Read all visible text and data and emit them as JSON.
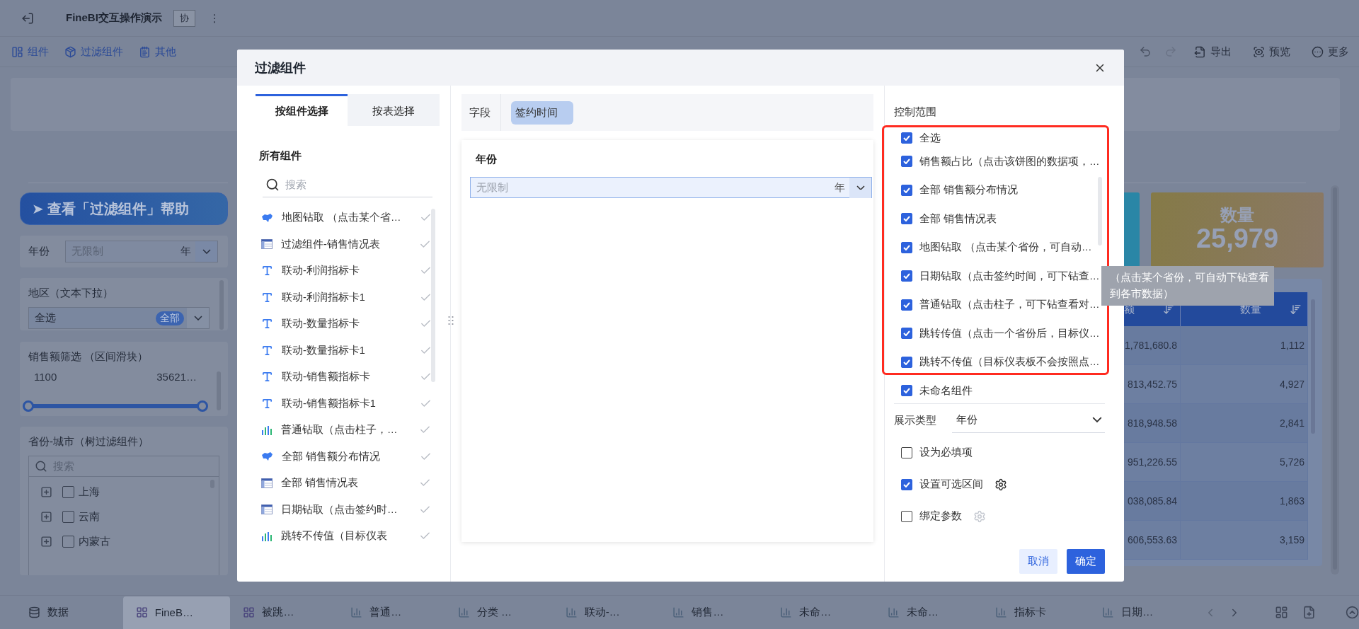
{
  "app_bar": {
    "title": "FineBI交互操作演示",
    "collab_tag": "协",
    "more": "⋮"
  },
  "toolbar": {
    "left": [
      "组件",
      "过滤组件",
      "其他"
    ],
    "right": [
      "导出",
      "预览",
      "更多"
    ]
  },
  "filters": {
    "help_button": "➤ 查看「过滤组件」帮助",
    "year": {
      "label": "年份",
      "placeholder": "无限制",
      "unit": "年"
    },
    "region": {
      "title": "地区（文本下拉）",
      "value": "全选",
      "badge": "全部"
    },
    "sales": {
      "title": "销售额筛选 （区间滑块）",
      "min": "1100",
      "max": "35621…",
      "level": 1
    },
    "province": {
      "title": "省份-城市（树过滤组件）",
      "placeholder": "搜索",
      "nodes": [
        {
          "label": "上海",
          "checked": false
        },
        {
          "label": "云南",
          "checked": false
        },
        {
          "label": "内蒙古",
          "checked": false
        }
      ]
    }
  },
  "kpi": {
    "title": "数量",
    "value": "25,979"
  },
  "table": {
    "columns": [
      "额",
      "数量"
    ],
    "rows": [
      [
        "1,781,680.8",
        "1,112"
      ],
      [
        "813,452.75",
        "4,927"
      ],
      [
        "818,948.58",
        "2,841"
      ],
      [
        "951,226.55",
        "5,726"
      ],
      [
        "038,085.84",
        "1,863"
      ],
      [
        "606,553.63",
        "3,159"
      ]
    ]
  },
  "tabs": [
    {
      "label": "数据",
      "kind": "data",
      "selected": false
    },
    {
      "label": "FineB…",
      "kind": "dashboard",
      "selected": true
    },
    {
      "label": "被跳…",
      "kind": "dashboard",
      "selected": false
    },
    {
      "label": "普通…",
      "kind": "chart",
      "selected": false
    },
    {
      "label": "分类 …",
      "kind": "chart",
      "selected": false
    },
    {
      "label": "联动-…",
      "kind": "chart",
      "selected": false
    },
    {
      "label": "销售…",
      "kind": "chart",
      "selected": false
    },
    {
      "label": "未命…",
      "kind": "chart",
      "selected": false
    },
    {
      "label": "未命…",
      "kind": "chart",
      "selected": false
    },
    {
      "label": "指标卡",
      "kind": "chart",
      "selected": false
    },
    {
      "label": "日期…",
      "kind": "chart",
      "selected": false
    }
  ],
  "dialog": {
    "title": "过滤组件",
    "tabs": [
      {
        "label": "按组件选择",
        "selected": true
      },
      {
        "label": "按表选择",
        "selected": false
      }
    ],
    "list_title": "所有组件",
    "search_placeholder": "搜索",
    "components": [
      {
        "kind": "map",
        "label": "地图钻取 （点击某个省…",
        "linked": true
      },
      {
        "kind": "table",
        "label": "过滤组件-销售情况表",
        "linked": true
      },
      {
        "kind": "text",
        "label": "联动-利润指标卡",
        "linked": true
      },
      {
        "kind": "text",
        "label": "联动-利润指标卡1",
        "linked": true
      },
      {
        "kind": "text",
        "label": "联动-数量指标卡",
        "linked": true
      },
      {
        "kind": "text",
        "label": "联动-数量指标卡1",
        "linked": true
      },
      {
        "kind": "text",
        "label": "联动-销售额指标卡",
        "linked": true
      },
      {
        "kind": "text",
        "label": "联动-销售额指标卡1",
        "linked": true
      },
      {
        "kind": "bar",
        "label": "普通钻取（点击柱子，…",
        "linked": true
      },
      {
        "kind": "map",
        "label": "全部 销售额分布情况",
        "linked": true
      },
      {
        "kind": "table",
        "label": "全部 销售情况表",
        "linked": true
      },
      {
        "kind": "table",
        "label": "日期钻取（点击签约时…",
        "linked": true
      },
      {
        "kind": "bar",
        "label": "跳转不传值（目标仪表",
        "linked": true
      }
    ],
    "field": {
      "label": "字段",
      "chip": "签约时间"
    },
    "preview": {
      "title": "年份",
      "placeholder": "无限制",
      "unit": "年"
    },
    "scope": {
      "title": "控制范围",
      "select_all": {
        "label": "全选",
        "checked": true
      },
      "items": [
        {
          "label": "销售额占比（点击该饼图的数据项，…",
          "checked": true
        },
        {
          "label": "全部 销售额分布情况",
          "checked": true
        },
        {
          "label": "全部 销售情况表",
          "checked": true
        },
        {
          "label": "地图钻取 （点击某个省份，可自动…",
          "checked": true
        },
        {
          "label": "日期钻取（点击签约时间，可下钻查…",
          "checked": true
        },
        {
          "label": "普通钻取（点击柱子，可下钻查看对…",
          "checked": true
        },
        {
          "label": "跳转传值（点击一个省份后，目标仪…",
          "checked": true
        },
        {
          "label": "跳转不传值（目标仪表板不会按照点…",
          "checked": true
        },
        {
          "label": "未命名组件",
          "checked": true
        }
      ]
    },
    "display_type": {
      "label": "展示类型",
      "value": "年份"
    },
    "options": [
      {
        "label": "设为必填项",
        "checked": false,
        "kind": "plain"
      },
      {
        "label": "设置可选区间",
        "checked": true,
        "kind": "settings",
        "disabled": false
      },
      {
        "label": "绑定参数",
        "checked": false,
        "kind": "settings",
        "disabled": true
      }
    ],
    "buttons": [
      {
        "label": "取消",
        "kind": "secondary"
      },
      {
        "label": "确定",
        "kind": "primary"
      }
    ],
    "tooltip": [
      "（点击某个省份，可自动下钻查看",
      "到各市数据）"
    ]
  }
}
